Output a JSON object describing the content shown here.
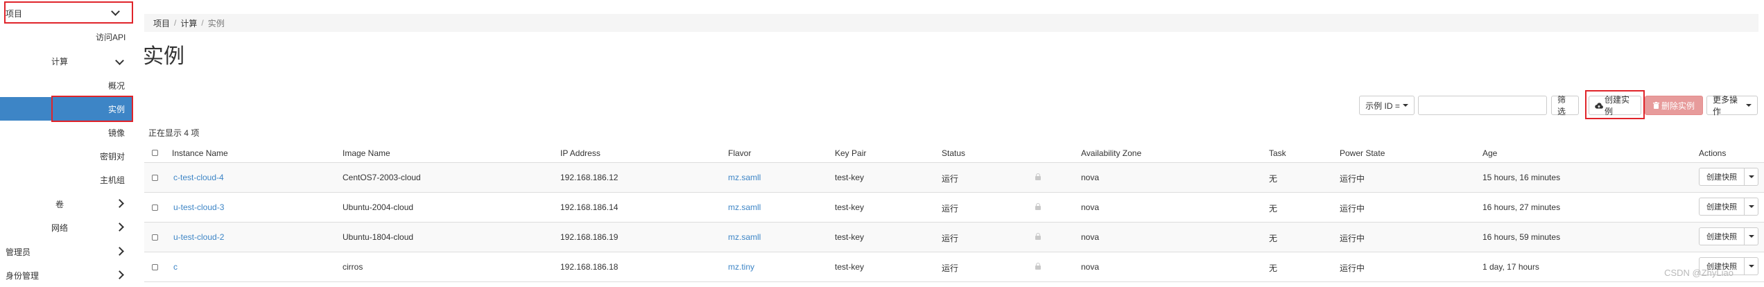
{
  "sidebar": {
    "project": "项目",
    "api_access": "访问API",
    "compute": "计算",
    "overview": "概况",
    "instances": "实例",
    "images": "镜像",
    "key_pairs": "密钥对",
    "host_groups": "主机组",
    "volumes": "卷",
    "network": "网络",
    "admin": "管理员",
    "identity": "身份管理"
  },
  "breadcrumb": {
    "project": "项目",
    "compute": "计算",
    "current": "实例",
    "separator": "/"
  },
  "page_title": "实例",
  "toolbar": {
    "filter_select": "示例 ID =",
    "filter_input_value": "",
    "filter_button": "筛选",
    "create_button": "创建实例",
    "delete_button": "删除实例",
    "more_actions": "更多操作"
  },
  "count_text": "正在显示 4 项",
  "table": {
    "headers": {
      "name": "Instance Name",
      "image": "Image Name",
      "ip": "IP Address",
      "flavor": "Flavor",
      "keypair": "Key Pair",
      "status": "Status",
      "az": "Availability Zone",
      "task": "Task",
      "power": "Power State",
      "age": "Age",
      "actions": "Actions"
    },
    "rows": [
      {
        "name": "c-test-cloud-4",
        "image": "CentOS7-2003-cloud",
        "ip": "192.168.186.12",
        "flavor": "mz.samll",
        "keypair": "test-key",
        "status": "运行",
        "az": "nova",
        "task": "无",
        "power": "运行中",
        "age": "15 hours, 16 minutes",
        "action": "创建快照"
      },
      {
        "name": "u-test-cloud-3",
        "image": "Ubuntu-2004-cloud",
        "ip": "192.168.186.14",
        "flavor": "mz.samll",
        "keypair": "test-key",
        "status": "运行",
        "az": "nova",
        "task": "无",
        "power": "运行中",
        "age": "16 hours, 27 minutes",
        "action": "创建快照"
      },
      {
        "name": "u-test-cloud-2",
        "image": "Ubuntu-1804-cloud",
        "ip": "192.168.186.19",
        "flavor": "mz.samll",
        "keypair": "test-key",
        "status": "运行",
        "az": "nova",
        "task": "无",
        "power": "运行中",
        "age": "16 hours, 59 minutes",
        "action": "创建快照"
      },
      {
        "name": "c",
        "image": "cirros",
        "ip": "192.168.186.18",
        "flavor": "mz.tiny",
        "keypair": "test-key",
        "status": "运行",
        "az": "nova",
        "task": "无",
        "power": "运行中",
        "age": "1 day, 17 hours",
        "action": "创建快照"
      }
    ]
  },
  "watermark": "CSDN @ZhyLiao",
  "colors": {
    "accent": "#3d85c6",
    "highlight_box": "#e0242a",
    "danger": "#e79b9b"
  },
  "icons": {
    "create": "cloud-upload-icon",
    "delete": "trash-icon",
    "status_lock": "lock-icon"
  }
}
